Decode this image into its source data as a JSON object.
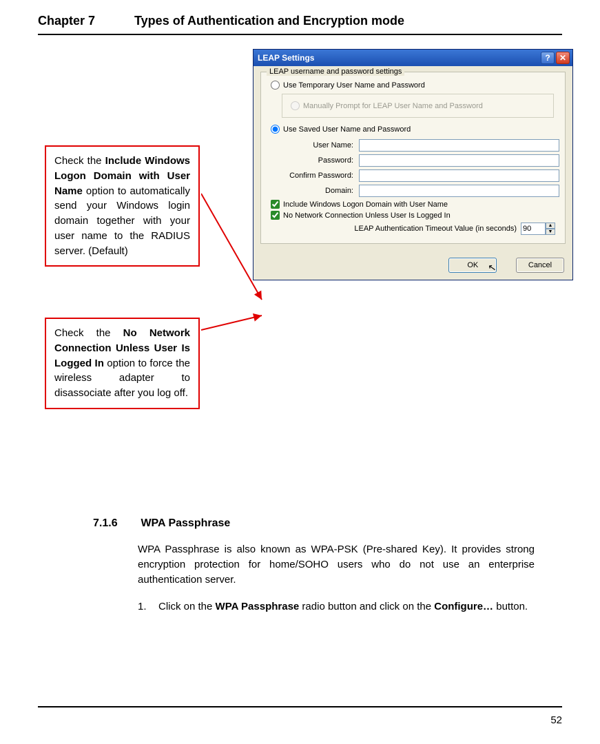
{
  "header": {
    "chapter_num": "Chapter 7",
    "chapter_title": "Types of Authentication and Encryption mode"
  },
  "callout1": {
    "pre": "Check the ",
    "bold": "Include Windows Logon Domain with User Name",
    "post": " option to automatically send your Windows login domain together with your user name to the RADIUS server. (Default)"
  },
  "callout2": {
    "pre": "Check the ",
    "bold": "No Network Connection Unless User Is Logged In",
    "post": " option to force the wireless adapter to disassociate after you log off."
  },
  "dialog": {
    "title": "LEAP Settings",
    "group_legend": "LEAP username and password settings",
    "radio_temp": "Use Temporary User Name and Password",
    "radio_manual": "Manually Prompt for LEAP User Name and Password",
    "radio_saved": "Use Saved User Name and Password",
    "labels": {
      "username": "User Name:",
      "password": "Password:",
      "confirm": "Confirm Password:",
      "domain": "Domain:"
    },
    "values": {
      "username": "",
      "password": "",
      "confirm": "",
      "domain": ""
    },
    "check_include": "Include Windows Logon Domain with User Name",
    "check_nonet": "No Network Connection Unless User Is Logged In",
    "timeout_label": "LEAP Authentication Timeout Value (in seconds)",
    "timeout_value": "90",
    "ok": "OK",
    "cancel": "Cancel"
  },
  "section": {
    "num": "7.1.6",
    "title": "WPA Passphrase",
    "para": "WPA Passphrase is also known as WPA-PSK (Pre-shared Key). It provides strong encryption protection for home/SOHO users who do not use an enterprise authentication server.",
    "step_num": "1.",
    "step_pre": "Click on the ",
    "step_bold1": "WPA Passphrase",
    "step_mid": " radio button and click on the ",
    "step_bold2": "Configure…",
    "step_post": " button."
  },
  "page_number": "52"
}
